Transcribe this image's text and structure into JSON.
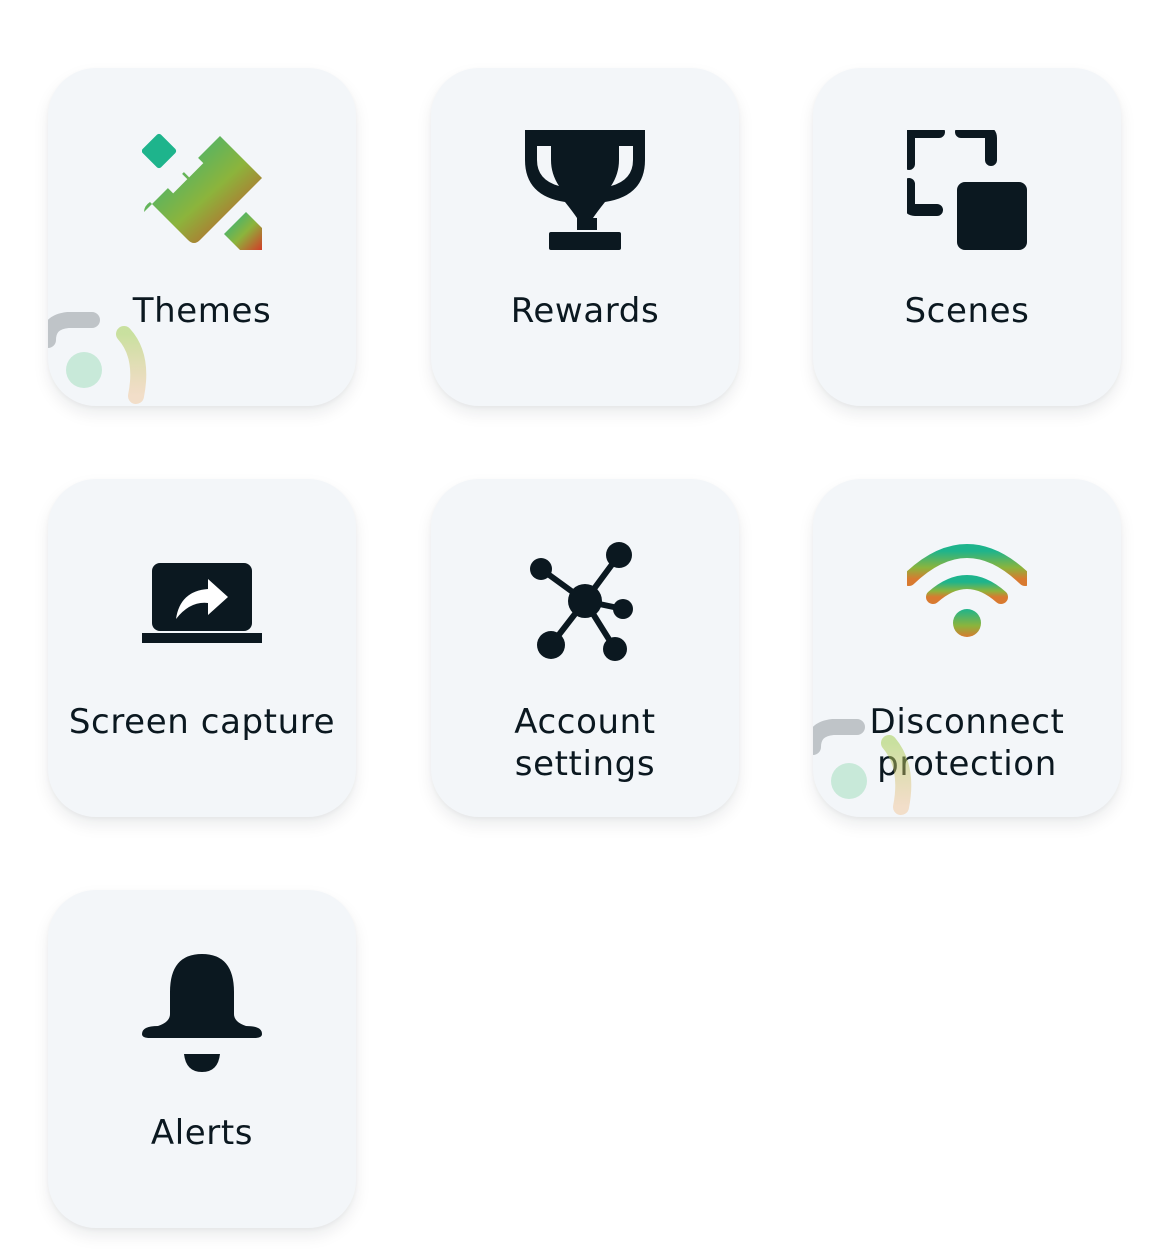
{
  "tiles": [
    {
      "id": "themes",
      "label": "Themes",
      "icon": "palette-ruler-pencil-icon",
      "has_badge": true
    },
    {
      "id": "rewards",
      "label": "Rewards",
      "icon": "trophy-icon",
      "has_badge": false
    },
    {
      "id": "scenes",
      "label": "Scenes",
      "icon": "scenes-frame-icon",
      "has_badge": false
    },
    {
      "id": "screen-capture",
      "label": "Screen capture",
      "icon": "laptop-share-icon",
      "has_badge": false
    },
    {
      "id": "account-settings",
      "label": "Account settings",
      "icon": "network-hub-icon",
      "has_badge": false
    },
    {
      "id": "disconnect-protection",
      "label": "Disconnect protection",
      "icon": "wifi-icon",
      "has_badge": true
    },
    {
      "id": "alerts",
      "label": "Alerts",
      "icon": "bell-icon",
      "has_badge": false
    }
  ],
  "colors": {
    "tile_bg": "#f3f6f9",
    "icon_dark": "#0b1820",
    "gradient_start": "#1eb48c",
    "gradient_mid": "#8cb43c",
    "gradient_end": "#d23c28",
    "badge_gray": "#bfc4c8"
  }
}
